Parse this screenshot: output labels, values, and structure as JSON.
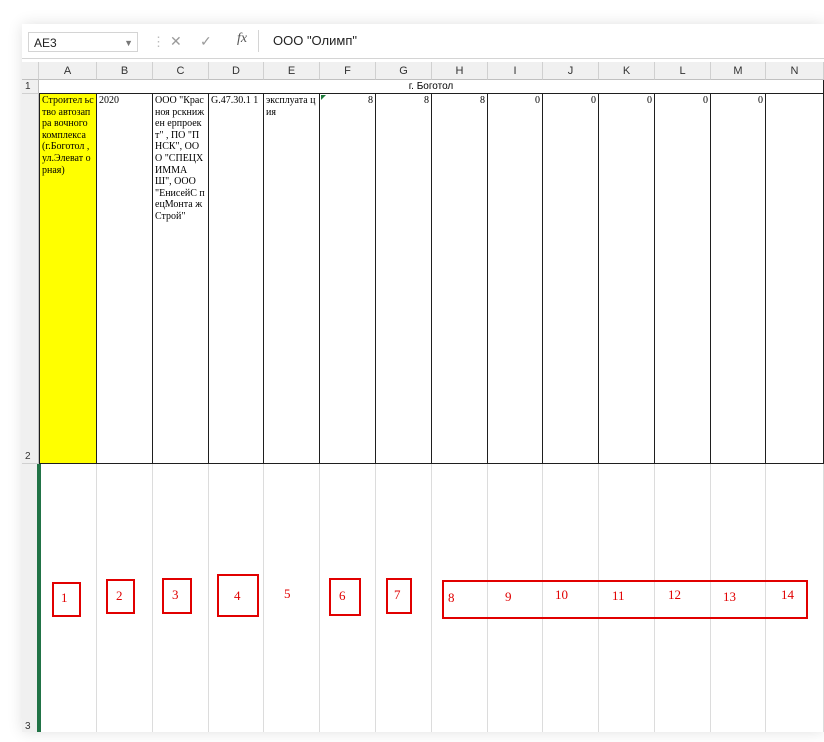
{
  "formula_bar": {
    "cell_ref": "AE3",
    "fx": "fx",
    "content": "ООО \"Олимп\""
  },
  "columns": [
    "A",
    "B",
    "C",
    "D",
    "E",
    "F",
    "G",
    "H",
    "I",
    "J",
    "K",
    "L",
    "M",
    "N"
  ],
  "rows": [
    "1",
    "2",
    "3"
  ],
  "row1": {
    "merged_title": "г. Боготол"
  },
  "row2": {
    "A": "Строител ьство автозапра вочного комплекса (г.Боготол , ул.Элеват орная)",
    "B": "2020",
    "C": "ООО \"Красноя рскнижен ерпроект\" , ПО \"ПНСК\", ООО \"СПЕЦХ ИММА Ш\", ООО \"ЕнисейС пецМонта жСтрой\"",
    "D": "G.47.30.1 1",
    "E": "эксплуата ция",
    "F": "8",
    "G": "8",
    "H": "8",
    "I": "0",
    "J": "0",
    "K": "0",
    "L": "0",
    "M": "0"
  },
  "annotations": [
    "1",
    "2",
    "3",
    "4",
    "5",
    "6",
    "7",
    "8",
    "9",
    "10",
    "11",
    "12",
    "13",
    "14"
  ],
  "colors": {
    "highlight": "#ffff00",
    "annotation_red": "#e10000",
    "selection_green": "#217346"
  }
}
